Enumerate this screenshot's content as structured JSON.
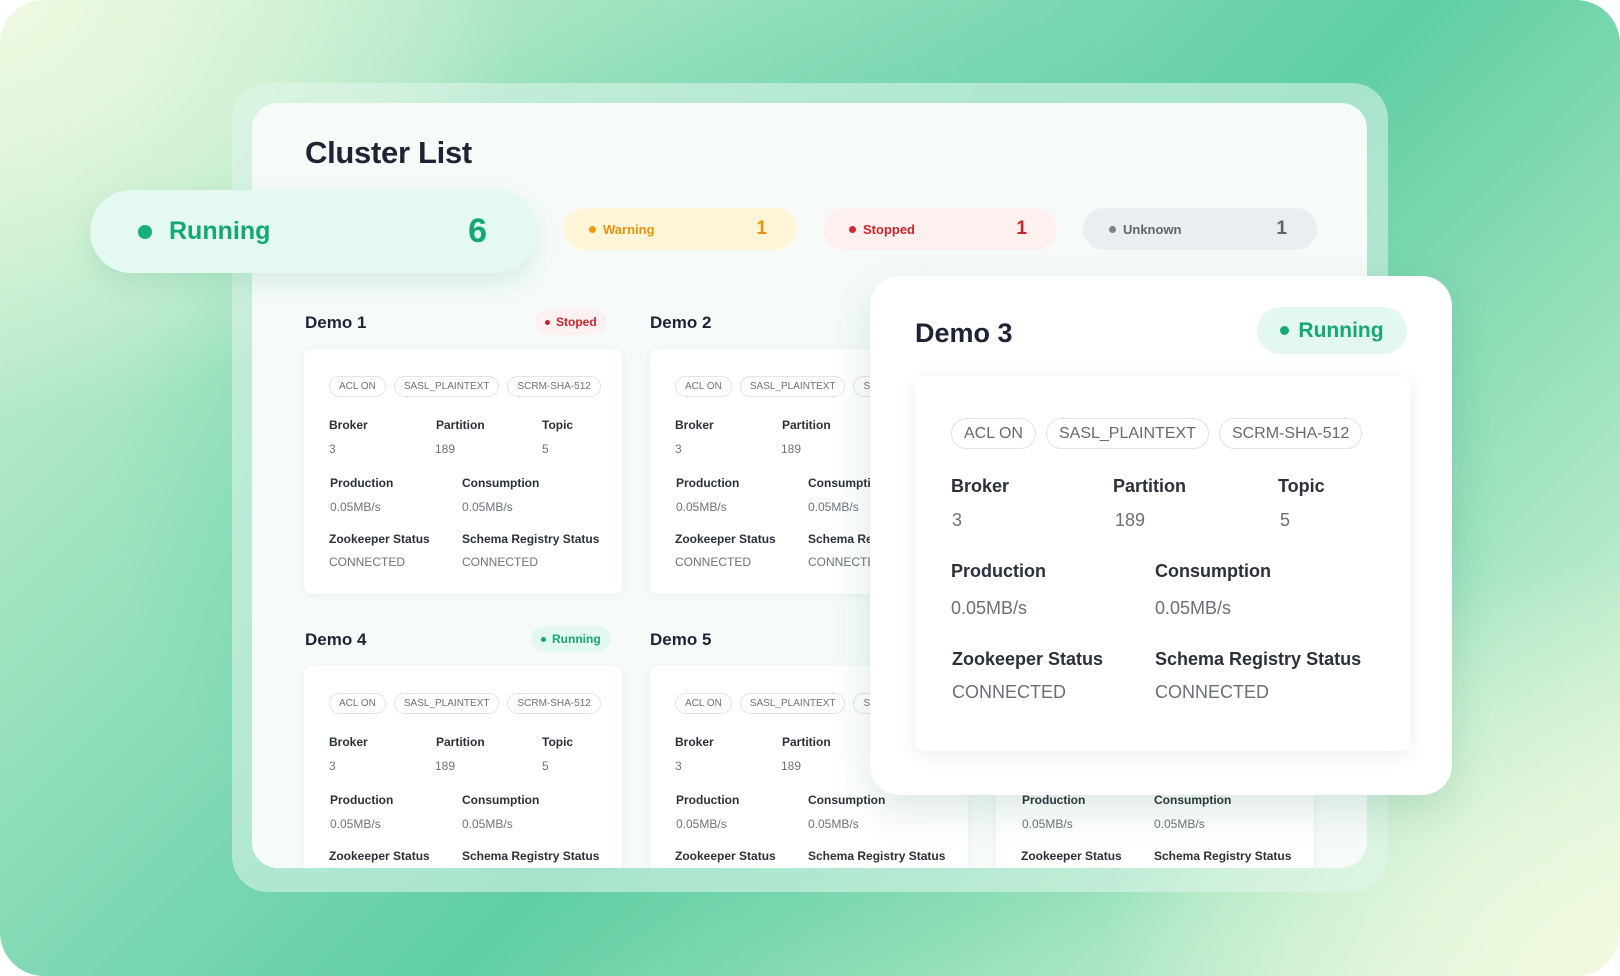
{
  "page": {
    "title": "Cluster List"
  },
  "summary": {
    "running": {
      "label": "Running",
      "count": "6",
      "color": "#14a872"
    },
    "warning": {
      "label": "Warning",
      "count": "1",
      "color": "#e8930d"
    },
    "stopped": {
      "label": "Stopped",
      "count": "1",
      "color": "#c8252e"
    },
    "unknown": {
      "label": "Unknown",
      "count": "1",
      "color": "#5e636d"
    }
  },
  "field_labels": {
    "broker": "Broker",
    "partition": "Partition",
    "topic": "Topic",
    "production": "Production",
    "consumption": "Consumption",
    "zookeeper": "Zookeeper Status",
    "schema_registry": "Schema Registry Status"
  },
  "clusters": [
    {
      "name": "Demo 1",
      "status": "Stoped",
      "tags": [
        "ACL ON",
        "SASL_PLAINTEXT",
        "SCRM-SHA-512"
      ],
      "broker": "3",
      "partition": "189",
      "topic": "5",
      "production": "0.05MB/s",
      "consumption": "0.05MB/s",
      "zookeeper": "CONNECTED",
      "schema_registry": "CONNECTED"
    },
    {
      "name": "Demo 2",
      "status": "",
      "tags": [
        "ACL ON",
        "SASL_PLAINTEXT",
        "SC"
      ],
      "broker": "3",
      "partition": "189",
      "topic": "",
      "production": "0.05MB/s",
      "consumption": "0.05MB/s",
      "zookeeper": "CONNECTED",
      "schema_registry": "CONNECTE"
    },
    {
      "name": "Demo 3",
      "status": "Running",
      "tags": [
        "ACL ON",
        "SASL_PLAINTEXT",
        "SCRM-SHA-512"
      ],
      "broker": "3",
      "partition": "189",
      "topic": "5",
      "production": "0.05MB/s",
      "consumption": "0.05MB/s",
      "zookeeper": "CONNECTED",
      "schema_registry": "CONNECTED"
    },
    {
      "name": "Demo 4",
      "status": "Running",
      "tags": [
        "ACL ON",
        "SASL_PLAINTEXT",
        "SCRM-SHA-512"
      ],
      "broker": "3",
      "partition": "189",
      "topic": "5",
      "production": "0.05MB/s",
      "consumption": "0.05MB/s",
      "zookeeper": "",
      "schema_registry": ""
    },
    {
      "name": "Demo 5",
      "status": "",
      "tags": [
        "ACL ON",
        "SASL_PLAINTEXT",
        "SC"
      ],
      "broker": "3",
      "partition": "189",
      "topic": "",
      "production": "0.05MB/s",
      "consumption": "0.05MB/s",
      "zookeeper": "",
      "schema_registry": ""
    },
    {
      "name": "",
      "status": "",
      "tags": [],
      "broker": "",
      "partition": "",
      "topic": "",
      "production": "0.05MB/s",
      "consumption": "0.05MB/s",
      "zookeeper": "",
      "schema_registry": ""
    }
  ]
}
